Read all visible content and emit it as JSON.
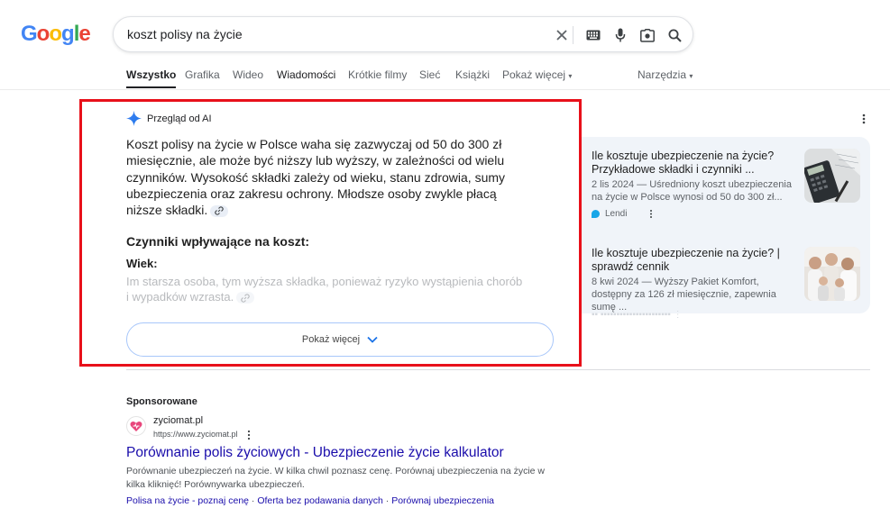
{
  "logo": {
    "letters": [
      "G",
      "o",
      "o",
      "g",
      "l",
      "e"
    ],
    "colors": [
      "#4285F4",
      "#EA4335",
      "#FBBC05",
      "#4285F4",
      "#34A853",
      "#EA4335"
    ]
  },
  "search": {
    "query": "koszt polisy na życie"
  },
  "tabs": [
    "Wszystko",
    "Grafika",
    "Wideo",
    "Wiadomości",
    "Krótkie filmy",
    "Sieć",
    "Książki",
    "Pokaż więcej"
  ],
  "tools_label": "Narzędzia",
  "ai_overview": {
    "label": "Przegląd od AI",
    "summary": "Koszt polisy na życie w Polsce waha się zazwyczaj od 50 do 300 zł miesięcznie, ale może być niższy lub wyższy, w zależności od wielu czynników. Wysokość składki zależy od wieku, stanu zdrowia, sumy ubezpieczenia oraz zakresu ochrony. Młodsze osoby zwykle płacą niższe składki.",
    "subheading": "Czynniki wpływające na koszt:",
    "factor_title": "Wiek:",
    "factor_text": "Im starsza osoba, tym wyższa składka, ponieważ ryzyko wystąpienia chorób i wypadków wzrasta.",
    "show_more": "Pokaż więcej"
  },
  "sources": [
    {
      "title": "Ile kosztuje ubezpieczenie na życie? Przykładowe składki i czynniki ...",
      "snippet": "2 lis 2024 — Uśredniony koszt ubezpieczenia na życie w Polsce wynosi od 50 do 300 zł...",
      "site": "Lendi"
    },
    {
      "title": "Ile kosztuje ubezpieczenie na życie? | sprawdź cennik",
      "snippet": "8 kwi 2024 — Wyższy Pakiet Komfort, dostępny za 126 zł miesięcznie, zapewnia sumę ..."
    }
  ],
  "sponsored": {
    "label": "Sponsorowane",
    "site_name": "zyciomat.pl",
    "url": "https://www.zyciomat.pl",
    "title": "Porównanie polis życiowych - Ubezpieczenie życie kalkulator",
    "description": "Porównanie ubezpieczeń na życie. W kilka chwil poznasz cenę. Porównaj ubezpieczenia na życie w kilka kliknięć! Porównywarka ubezpieczeń.",
    "links": [
      "Polisa na życie - poznaj cenę",
      "Oferta bez podawania danych",
      "Porównaj ubezpieczenia"
    ]
  }
}
